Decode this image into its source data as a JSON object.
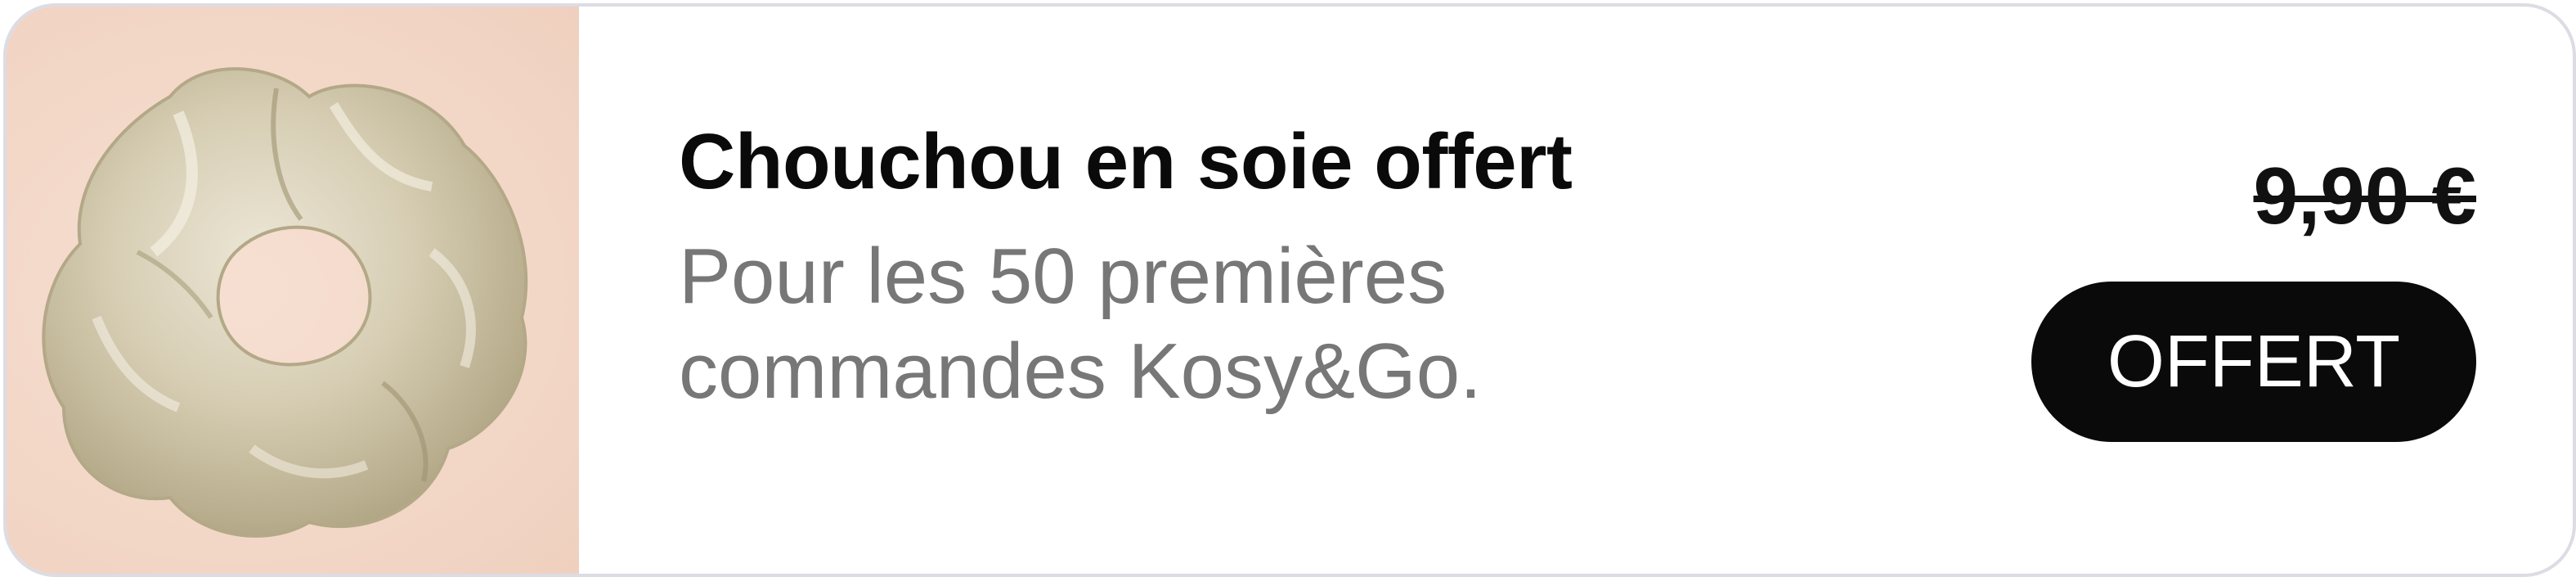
{
  "product": {
    "title": "Chouchou en soie offert",
    "subtitle": "Pour les 50 premières commandes Kosy&Go.",
    "image_icon": "scrunchie-image"
  },
  "pricing": {
    "old_price": "9,90 €",
    "badge_label": "OFFERT"
  },
  "colors": {
    "badge_bg": "#0a0a0a",
    "subtitle": "#777777",
    "image_bg": "#f3d8c8"
  }
}
